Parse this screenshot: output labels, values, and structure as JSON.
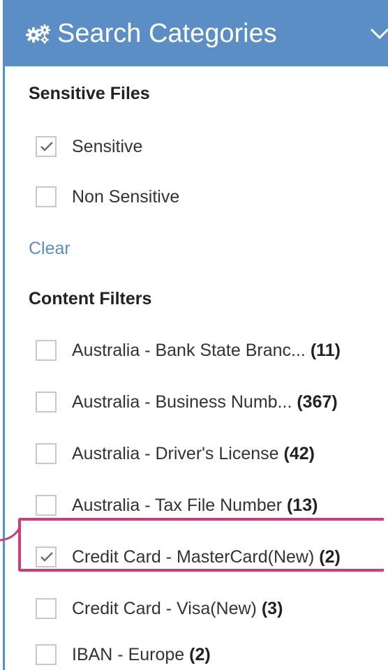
{
  "header": {
    "title": "Search Categories",
    "icon": "gears-icon",
    "toggle_icon": "chevron-down-icon",
    "background": "#5b8ec5"
  },
  "sensitive_files": {
    "title": "Sensitive Files",
    "options": [
      {
        "label": "Sensitive",
        "checked": true
      },
      {
        "label": "Non Sensitive",
        "checked": false
      }
    ],
    "clear_label": "Clear"
  },
  "content_filters": {
    "title": "Content Filters",
    "items": [
      {
        "label": "Australia - Bank State Branc...",
        "count": "(11)",
        "checked": false
      },
      {
        "label": "Australia - Business Numb...",
        "count": "(367)",
        "checked": false
      },
      {
        "label": "Australia - Driver's License",
        "count": "(42)",
        "checked": false
      },
      {
        "label": "Australia - Tax File Number",
        "count": "(13)",
        "checked": false
      },
      {
        "label": "Credit Card - MasterCard(New)",
        "count": "(2)",
        "checked": true,
        "highlighted": true
      },
      {
        "label": "Credit Card - Visa(New)",
        "count": "(3)",
        "checked": false
      },
      {
        "label": "IBAN - Europe",
        "count": "(2)",
        "checked": false
      }
    ]
  },
  "colors": {
    "accent": "#5b8ec5",
    "highlight": "#cc3f75"
  }
}
